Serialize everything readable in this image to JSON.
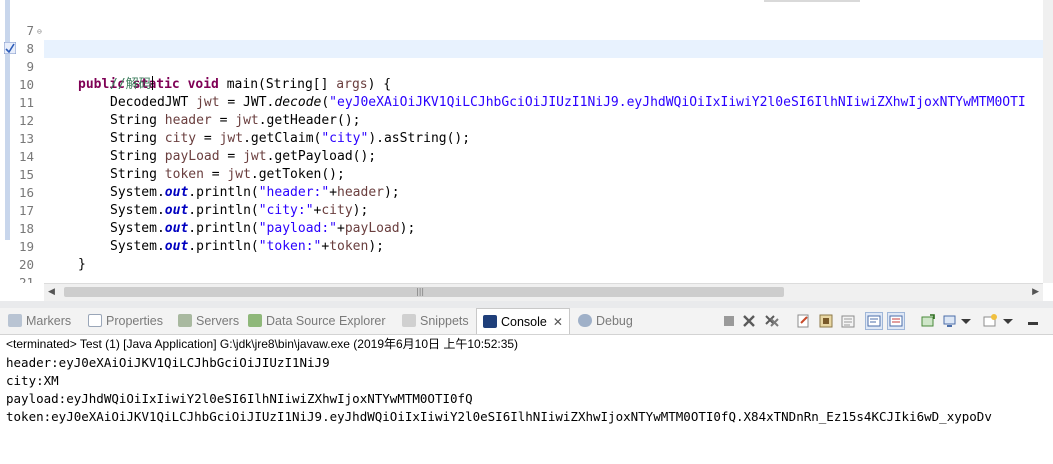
{
  "editor": {
    "lines": [
      {
        "n": "7"
      },
      {
        "n": "8",
        "t1": "public static void",
        "t2": " main(String[] ",
        "t3": "args",
        "t4": ") {"
      },
      {
        "n": "9",
        "com": "//解码"
      },
      {
        "n": "10",
        "a": "DecodedJWT ",
        "v": "jwt",
        "b": " = JWT.",
        "m": "decode",
        "c": "(",
        "s": "\"eyJ0eXAiOiJKV1QiLCJhbGciOiJIUzI1NiJ9.eyJhdWQiOiIxIiwiY2l0eSI6IlhNIiwiZXhwIjoxNTYwMTM0OTI"
      },
      {
        "n": "11",
        "a": "String ",
        "v": "header",
        "b": " = ",
        "v2": "jwt",
        "c": ".getHeader();"
      },
      {
        "n": "12",
        "a": "String ",
        "v": "city",
        "b": " = ",
        "v2": "jwt",
        "c": ".getClaim(",
        "s": "\"city\"",
        "d": ").asString();"
      },
      {
        "n": "13",
        "a": "String ",
        "v": "payLoad",
        "b": " = ",
        "v2": "jwt",
        "c": ".getPayload();"
      },
      {
        "n": "14",
        "a": "String ",
        "v": "token",
        "b": " = ",
        "v2": "jwt",
        "c": ".getToken();"
      },
      {
        "n": "15",
        "a": "System.",
        "f": "out",
        "b": ".println(",
        "s": "\"header:\"",
        "c": "+",
        "v": "header",
        "d": ");"
      },
      {
        "n": "16",
        "a": "System.",
        "f": "out",
        "b": ".println(",
        "s": "\"city:\"",
        "c": "+",
        "v": "city",
        "d": ");"
      },
      {
        "n": "17",
        "a": "System.",
        "f": "out",
        "b": ".println(",
        "s": "\"payload:\"",
        "c": "+",
        "v": "payLoad",
        "d": ");"
      },
      {
        "n": "18",
        "a": "System.",
        "f": "out",
        "b": ".println(",
        "s": "\"token:\"",
        "c": "+",
        "v": "token",
        "d": ");"
      },
      {
        "n": "19",
        "a": "}"
      },
      {
        "n": "20"
      },
      {
        "n": "21",
        "a": "}"
      }
    ],
    "scroll_grip": "|||"
  },
  "views": {
    "tabs": [
      {
        "label": "Markers"
      },
      {
        "label": "Properties"
      },
      {
        "label": "Servers"
      },
      {
        "label": "Data Source Explorer"
      },
      {
        "label": "Snippets"
      },
      {
        "label": "Console",
        "active": true
      },
      {
        "label": "Debug"
      }
    ],
    "close_glyph": "✕"
  },
  "console": {
    "terminated": "<terminated> Test (1) [Java Application] G:\\jdk\\jre8\\bin\\javaw.exe (2019年6月10日 上午10:52:35)",
    "output": [
      "header:eyJ0eXAiOiJKV1QiLCJhbGciOiJIUzI1NiJ9",
      "city:XM",
      "payload:eyJhdWQiOiIxIiwiY2l0eSI6IlhNIiwiZXhwIjoxNTYwMTM0OTI0fQ",
      "token:eyJ0eXAiOiJKV1QiLCJhbGciOiJIUzI1NiJ9.eyJhdWQiOiIxIiwiY2l0eSI6IlhNIiwiZXhwIjoxNTYwMTM0OTI0fQ.X84xTNDnRn_Ez15s4KCJIki6wD_xypoDv"
    ]
  },
  "colors": {
    "keyword": "#7f0055",
    "string": "#2a00ff",
    "comment": "#3f7f5f",
    "field": "#0000c0",
    "local_var": "#6a3e3e"
  },
  "icons": [
    "warning-marker-icon",
    "markers-icon",
    "properties-icon",
    "servers-icon",
    "data-source-icon",
    "snippets-icon",
    "console-icon",
    "debug-icon",
    "terminate-icon",
    "remove-launch-icon",
    "remove-all-icon",
    "scroll-lock-icon",
    "clear-console-icon",
    "word-wrap-icon",
    "pin-console-icon",
    "display-console-icon",
    "open-console-icon",
    "minimize-icon"
  ]
}
